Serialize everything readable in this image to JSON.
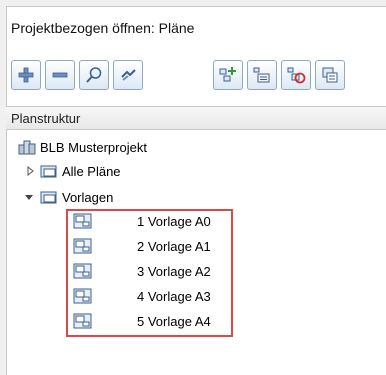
{
  "window": {
    "title": "Projektbezogen öffnen: Pläne"
  },
  "toolbar": {
    "buttons": [
      {
        "icon": "add-icon"
      },
      {
        "icon": "remove-icon"
      },
      {
        "icon": "search-icon"
      },
      {
        "icon": "link-icon"
      },
      {
        "icon": "structure-add-icon"
      },
      {
        "icon": "structure-list-icon"
      },
      {
        "icon": "structure-delete-icon"
      },
      {
        "icon": "structure-copy-icon"
      }
    ]
  },
  "panel": {
    "header": "Planstruktur"
  },
  "tree": {
    "project": {
      "label": "BLB Musterprojekt",
      "icon": "project-icon"
    },
    "groups": [
      {
        "label": "Alle Pläne",
        "expanded": false,
        "icon": "folder-icon"
      },
      {
        "label": "Vorlagen",
        "expanded": true,
        "icon": "folder-icon"
      }
    ],
    "templates": [
      {
        "label": "1 Vorlage A0",
        "icon": "plan-template-icon"
      },
      {
        "label": "2 Vorlage A1",
        "icon": "plan-template-icon"
      },
      {
        "label": "3 Vorlage A2",
        "icon": "plan-template-icon"
      },
      {
        "label": "4 Vorlage A3",
        "icon": "plan-template-icon"
      },
      {
        "label": "5 Vorlage A4",
        "icon": "plan-template-icon"
      }
    ]
  },
  "colors": {
    "highlight_border": "#d84a48",
    "button_border": "#8fa8c6"
  }
}
